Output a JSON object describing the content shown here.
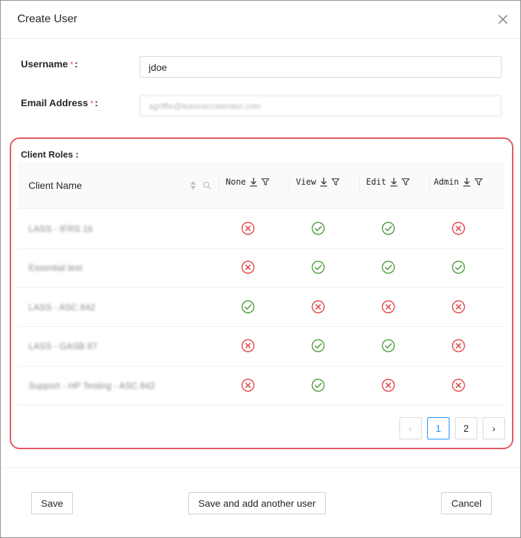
{
  "dialog": {
    "title": "Create User"
  },
  "form": {
    "username_label": "Username",
    "username_value": "jdoe",
    "email_label": "Email Address",
    "email_value": "agriffie@leaseaccelerator.com",
    "required_mark": "*",
    "colon": ":"
  },
  "roles": {
    "section_label": "Client Roles :",
    "name_header": "Client Name",
    "columns": [
      "None",
      "View",
      "Edit",
      "Admin"
    ],
    "rows": [
      {
        "client": "LASS - IFRS 16",
        "none": false,
        "view": true,
        "edit": true,
        "admin": false
      },
      {
        "client": "Essential test",
        "none": false,
        "view": true,
        "edit": true,
        "admin": true
      },
      {
        "client": "LASS - ASC 842",
        "none": true,
        "view": false,
        "edit": false,
        "admin": false
      },
      {
        "client": "LASS - GASB 87",
        "none": false,
        "view": true,
        "edit": true,
        "admin": false
      },
      {
        "client": "Support - HP Testing - ASC 842",
        "none": false,
        "view": true,
        "edit": false,
        "admin": false
      }
    ]
  },
  "pagination": {
    "pages": [
      "1",
      "2"
    ],
    "current": "1",
    "prev_glyph": "‹",
    "next_glyph": "›"
  },
  "footer": {
    "save_label": "Save",
    "save_add_label": "Save and add another user",
    "cancel_label": "Cancel"
  },
  "colors": {
    "check": "#52a043",
    "cross": "#e5484d",
    "accent": "#1890ff",
    "highlight": "#e0535d"
  },
  "icons": {
    "allowed": "check-circle-icon",
    "denied": "close-circle-icon",
    "close": "close-icon",
    "sort": "sort-icon",
    "filter": "filter-icon",
    "search": "search-icon",
    "download": "download-icon"
  }
}
